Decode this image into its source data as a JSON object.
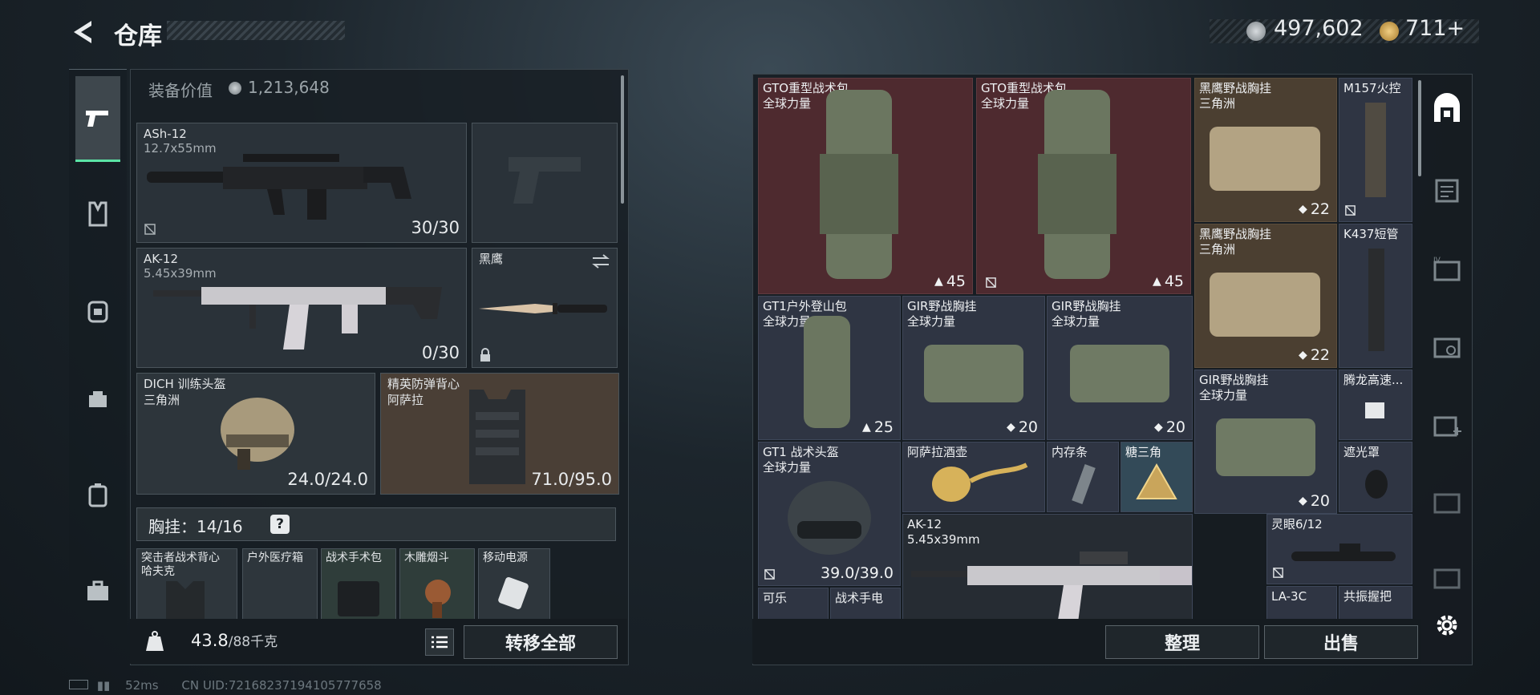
{
  "header": {
    "title": "仓库"
  },
  "currency": [
    {
      "icon": "coin-icon",
      "value": "497,602"
    },
    {
      "icon": "delta-coin-icon",
      "value": "711",
      "plus": "+"
    }
  ],
  "loadout": {
    "equip_value_label": "装备价值",
    "equip_value": "1,213,648",
    "slots": {
      "primary": {
        "name": "ASh-12",
        "caliber": "12.7x55mm",
        "ammo": "30/30"
      },
      "secondary": {
        "name": "AK-12",
        "caliber": "5.45x39mm",
        "ammo": "0/30"
      },
      "melee": {
        "name": "黑鹰"
      },
      "helmet": {
        "name": "DICH 训练头盔",
        "sub": "三角洲",
        "durability": "24.0/24.0"
      },
      "armor": {
        "name": "精英防弹背心",
        "sub": "阿萨拉",
        "durability": "71.0/95.0"
      }
    },
    "chest": {
      "label": "胸挂：14/16",
      "help": "?"
    },
    "chest_items": [
      {
        "name": "突击者战术背心",
        "sub": "哈夫克"
      },
      {
        "name": "户外医疗箱"
      },
      {
        "name": "战术手术包"
      },
      {
        "name": "木雕烟斗"
      },
      {
        "name": "移动电源"
      }
    ],
    "weight": {
      "value": "43.8",
      "max": "/88千克"
    },
    "transfer_all": "转移全部"
  },
  "storage": {
    "cells": [
      {
        "name": "GTO重型战术包",
        "sub": "全球力量",
        "count": "45"
      },
      {
        "name": "GTO重型战术包",
        "sub": "全球力量",
        "count": "45"
      },
      {
        "name": "黑鹰野战胸挂",
        "sub": "三角洲",
        "count": "22"
      },
      {
        "name": "M157火控"
      },
      {
        "name": "黑鹰野战胸挂",
        "sub": "三角洲",
        "count": "22"
      },
      {
        "name": "K437短管"
      },
      {
        "name": "GT1户外登山包",
        "sub": "全球力量",
        "count": "25"
      },
      {
        "name": "GIR野战胸挂",
        "sub": "全球力量",
        "count": "20"
      },
      {
        "name": "GIR野战胸挂",
        "sub": "全球力量",
        "count": "20"
      },
      {
        "name": "GIR野战胸挂",
        "sub": "全球力量",
        "count": "20"
      },
      {
        "name": "腾龙高速..."
      },
      {
        "name": "GT1 战术头盔",
        "sub": "全球力量",
        "durability": "39.0/39.0"
      },
      {
        "name": "阿萨拉酒壶"
      },
      {
        "name": "内存条"
      },
      {
        "name": "糖三角"
      },
      {
        "name": "遮光罩"
      },
      {
        "name": "AK-12",
        "sub": "5.45x39mm"
      },
      {
        "name": "灵眼6/12"
      },
      {
        "name": "可乐"
      },
      {
        "name": "战术手电"
      },
      {
        "name": "LA-3C"
      },
      {
        "name": "共振握把"
      }
    ],
    "sort_label": "整理",
    "sell_label": "出售"
  },
  "status": {
    "ping": "52ms",
    "uid": "CN UID:72168237194105777658"
  },
  "colors": {
    "accent": "#5be4a6",
    "red_cell": "#4e2a2f",
    "gold_cell": "#4b3f31",
    "blue_cell": "#2f3543"
  }
}
